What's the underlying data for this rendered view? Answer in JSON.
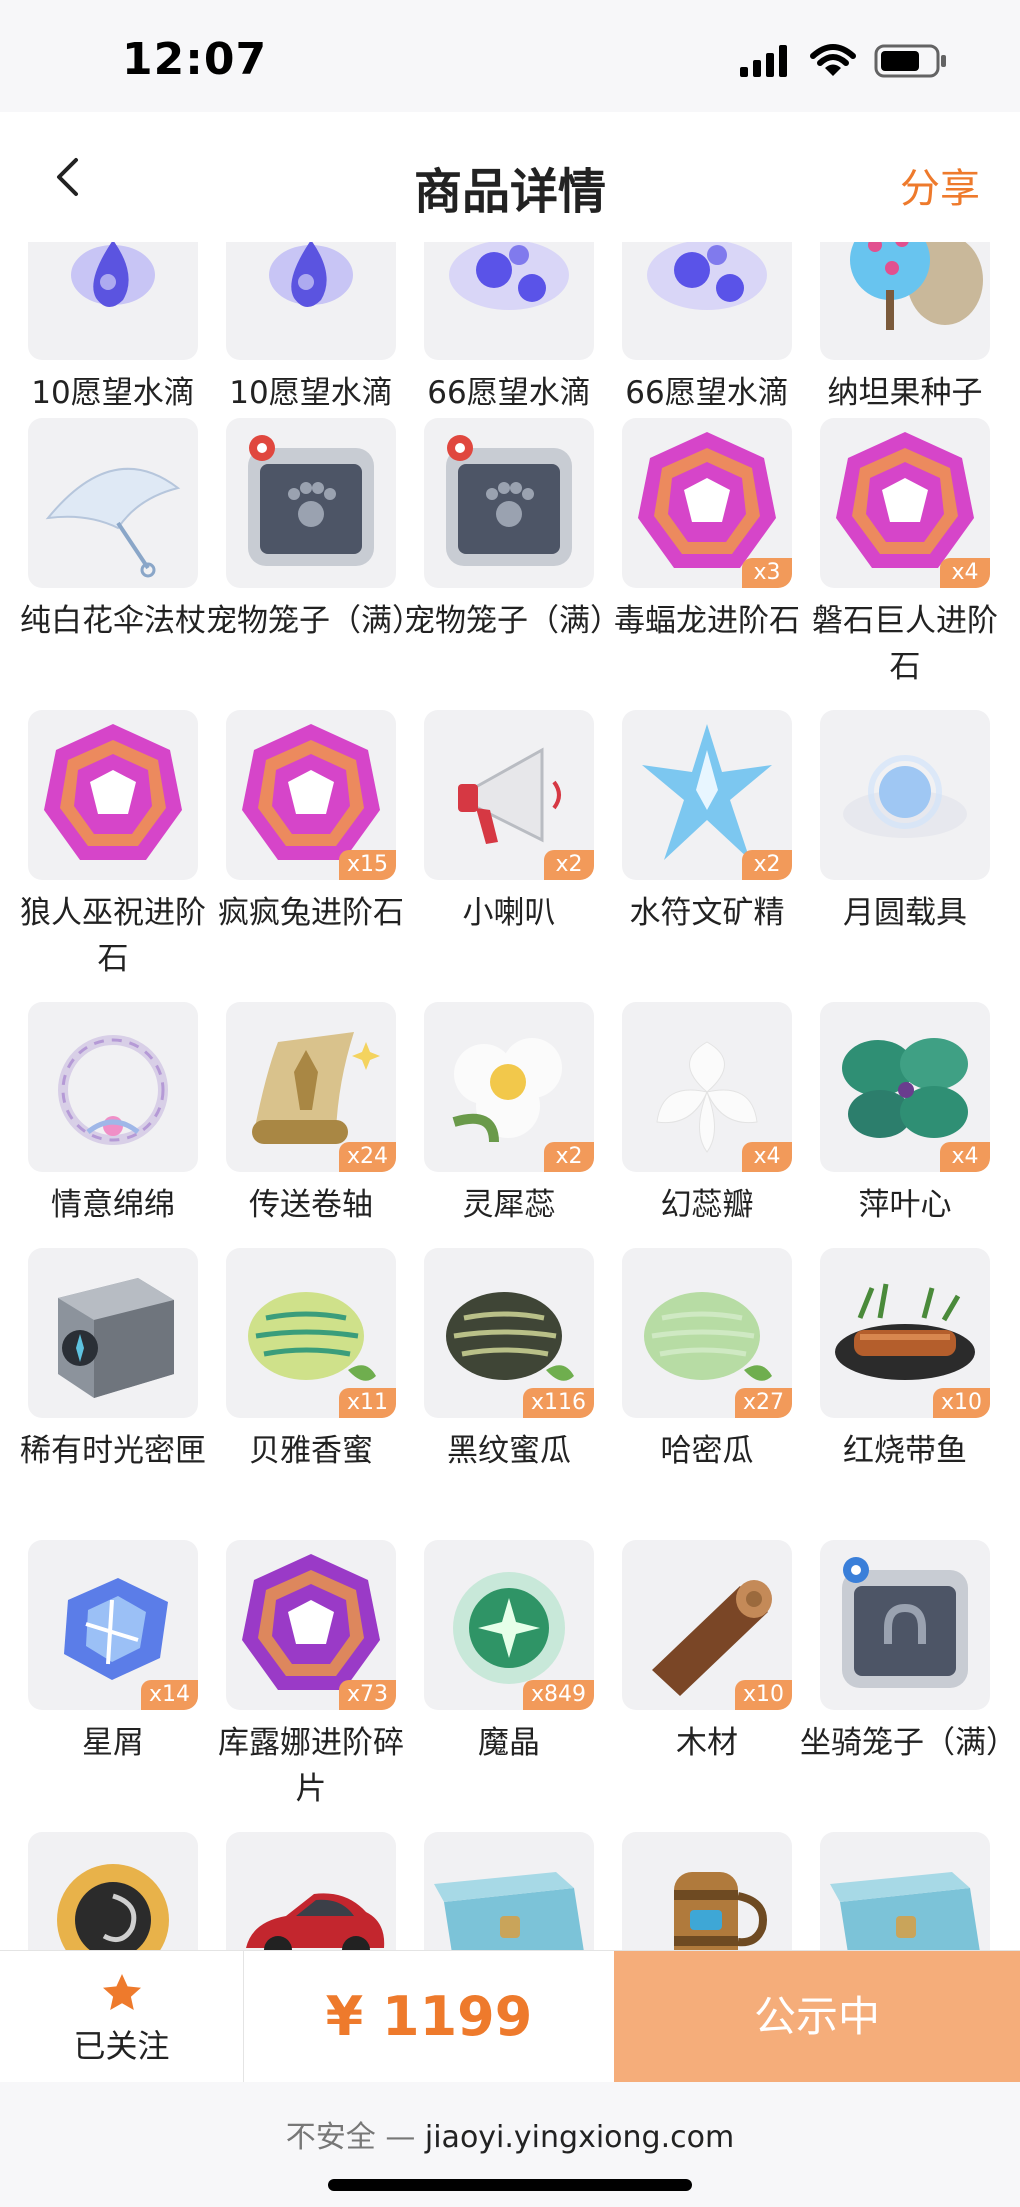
{
  "status": {
    "time": "12:07"
  },
  "nav": {
    "title": "商品详情",
    "share_label": "分享"
  },
  "items": [
    {
      "name": "10愿望水滴",
      "qty": "",
      "icon": "water-drop-icon",
      "color": "#5b54e0"
    },
    {
      "name": "10愿望水滴",
      "qty": "",
      "icon": "water-drop-icon",
      "color": "#5b54e0"
    },
    {
      "name": "66愿望水滴",
      "qty": "",
      "icon": "water-drops-icon",
      "color": "#5a53e8"
    },
    {
      "name": "66愿望水滴",
      "qty": "",
      "icon": "water-drops-icon",
      "color": "#5a53e8"
    },
    {
      "name": "纳坦果种子",
      "qty": "",
      "icon": "seed-bag-icon",
      "color": "#68c4ef"
    },
    {
      "name": "纯白花伞法杖",
      "qty": "",
      "icon": "umbrella-staff-icon",
      "color": "#dfe9f5"
    },
    {
      "name": "宠物笼子（满）",
      "qty": "",
      "icon": "pet-cage-icon",
      "color": "#4d5566"
    },
    {
      "name": "宠物笼子（满）",
      "qty": "",
      "icon": "pet-cage-icon",
      "color": "#4d5566"
    },
    {
      "name": "毒蝠龙进阶石",
      "qty": "x3",
      "icon": "gem-icon",
      "color": "#d645c9"
    },
    {
      "name": "磐石巨人进阶石",
      "qty": "x4",
      "icon": "gem-icon",
      "color": "#d645c9"
    },
    {
      "name": "狼人巫祝进阶石",
      "qty": "",
      "icon": "gem-icon",
      "color": "#d645c9"
    },
    {
      "name": "疯疯兔进阶石",
      "qty": "x15",
      "icon": "gem-icon",
      "color": "#d645c9"
    },
    {
      "name": "小喇叭",
      "qty": "x2",
      "icon": "megaphone-icon",
      "color": "#d63843"
    },
    {
      "name": "水符文矿精",
      "qty": "x2",
      "icon": "crystal-icon",
      "color": "#6fc2ef"
    },
    {
      "name": "月圆载具",
      "qty": "",
      "icon": "moon-cloud-icon",
      "color": "#9fc7f3"
    },
    {
      "name": "情意绵绵",
      "qty": "",
      "icon": "wreath-icon",
      "color": "#b59ad6"
    },
    {
      "name": "传送卷轴",
      "qty": "x24",
      "icon": "scroll-icon",
      "color": "#a98744"
    },
    {
      "name": "灵犀蕊",
      "qty": "x2",
      "icon": "flower-icon",
      "color": "#f4e9b8"
    },
    {
      "name": "幻蕊瓣",
      "qty": "x4",
      "icon": "petal-icon",
      "color": "#fbfbfb"
    },
    {
      "name": "萍叶心",
      "qty": "x4",
      "icon": "leaf-icon",
      "color": "#2f8f74"
    },
    {
      "name": "稀有时光密匣",
      "qty": "",
      "icon": "box-icon",
      "color": "#8c939c"
    },
    {
      "name": "贝雅香蜜",
      "qty": "x11",
      "icon": "melon-icon",
      "color": "#cfe18a"
    },
    {
      "name": "黑纹蜜瓜",
      "qty": "x116",
      "icon": "melon-icon",
      "color": "#3f4536"
    },
    {
      "name": "哈密瓜",
      "qty": "x27",
      "icon": "melon-icon",
      "color": "#b7dca4"
    },
    {
      "name": "红烧带鱼",
      "qty": "x10",
      "icon": "fish-dish-icon",
      "color": "#b45e2c"
    },
    {
      "name": "星屑",
      "qty": "x14",
      "icon": "stardust-icon",
      "color": "#5b7de8"
    },
    {
      "name": "库露娜进阶碎片",
      "qty": "x73",
      "icon": "gem-icon",
      "color": "#9a3ac7"
    },
    {
      "name": "魔晶",
      "qty": "x849",
      "icon": "magic-crystal-icon",
      "color": "#4fcf8a"
    },
    {
      "name": "木材",
      "qty": "x10",
      "icon": "wood-icon",
      "color": "#7a4626"
    },
    {
      "name": "坐骑笼子（满）",
      "qty": "",
      "icon": "mount-cage-icon",
      "color": "#4d5566"
    },
    {
      "name": "",
      "qty": "",
      "icon": "sun-vortex-icon",
      "color": "#2b2b2b"
    },
    {
      "name": "",
      "qty": "",
      "icon": "car-icon",
      "color": "#c3262e"
    },
    {
      "name": "",
      "qty": "",
      "icon": "chest-icon",
      "color": "#7cc3d8"
    },
    {
      "name": "",
      "qty": "",
      "icon": "barrel-mug-icon",
      "color": "#b07a3c"
    },
    {
      "name": "",
      "qty": "",
      "icon": "chest-icon",
      "color": "#7cc3d8"
    }
  ],
  "bottom": {
    "follow_label": "已关注",
    "price": "¥ 1199",
    "cta_label": "公示中"
  },
  "url_bar": {
    "insecure_label": "不安全 —",
    "domain": "jiaoyi.yingxiong.com"
  },
  "colors": {
    "accent": "#ee7a2c",
    "qty_badge": "#f29a5a",
    "cta_bg": "#f5ad7a"
  }
}
